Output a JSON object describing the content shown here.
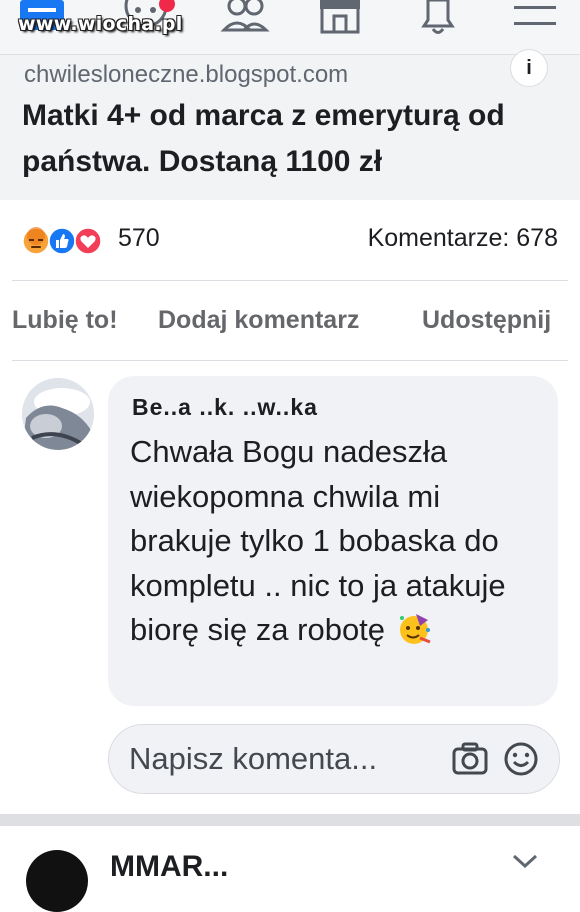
{
  "watermark": "www.wiocha.pl",
  "nav": {
    "icons": [
      "home-icon",
      "groups-icon",
      "people-icon",
      "marketplace-icon",
      "notifications-icon",
      "menu-icon"
    ]
  },
  "link_preview": {
    "domain": "chwilesloneczne.blogspot.com",
    "title": "Matki 4+ od marca z emeryturą od państwa. Dostaną 1100 zł",
    "info_label": "i"
  },
  "reactions": {
    "icons": [
      "angry-icon",
      "like-icon",
      "love-icon"
    ],
    "count": "570",
    "comments_label": "Komentarze: 678"
  },
  "actions": {
    "like": "Lubię to!",
    "comment": "Dodaj komentarz",
    "share": "Udostępnij"
  },
  "comment": {
    "author": "Be..a ..k. ..w..ka",
    "text": "Chwała Bogu nadeszła wiekopomna chwila mi brakuje tylko 1 bobaska do kompletu .. nic to ja atakuje biorę się za robotę",
    "emoji": "partying-face-icon"
  },
  "write_comment": {
    "placeholder": "Napisz komenta..."
  },
  "next_post": {
    "author": "MMAR..."
  },
  "colors": {
    "like_blue": "#1877f2",
    "love_red": "#f33e58",
    "angry_orange": "#e9710f",
    "text_primary": "#1c1e21",
    "text_secondary": "#65676b"
  }
}
